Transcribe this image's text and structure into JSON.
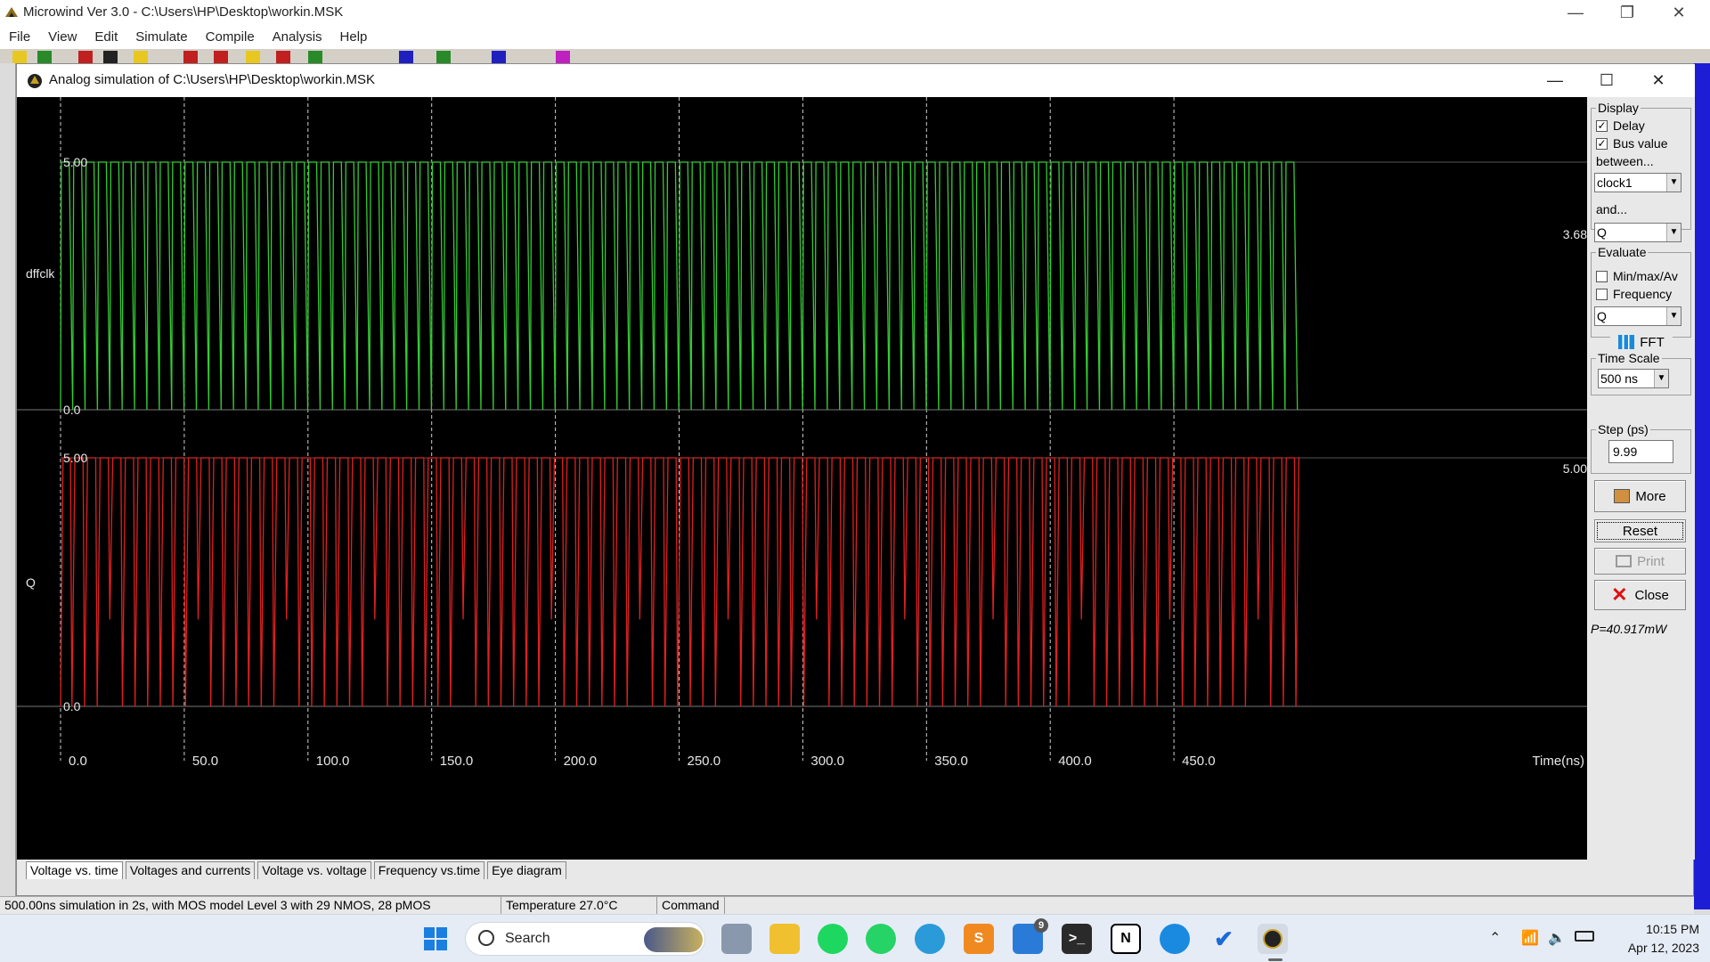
{
  "window": {
    "title": "Microwind Ver 3.0 - C:\\Users\\HP\\Desktop\\workin.MSK",
    "minimize": "—",
    "maximize": "❐",
    "close": "✕"
  },
  "menu": [
    "File",
    "View",
    "Edit",
    "Simulate",
    "Compile",
    "Analysis",
    "Help"
  ],
  "sim": {
    "title": "Analog simulation of C:\\Users\\HP\\Desktop\\workin.MSK",
    "minimize": "—",
    "maximize": "☐",
    "close": "✕"
  },
  "plot": {
    "signals": [
      {
        "name": "dffclk",
        "color": "#33cc33",
        "vmax": "5.00",
        "vmin": "0.0",
        "right_value": "3.68"
      },
      {
        "name": "Q",
        "color": "#e02020",
        "vmax": "5.00",
        "vmin": "0.0",
        "right_value": "5.00"
      }
    ],
    "x_ticks": [
      "0.0",
      "50.0",
      "100.0",
      "150.0",
      "200.0",
      "250.0",
      "300.0",
      "350.0",
      "400.0",
      "450.0"
    ],
    "x_label": "Time(ns)",
    "x_range": [
      0,
      500
    ]
  },
  "panel": {
    "display_label": "Display",
    "delay_label": "Delay",
    "delay_checked": true,
    "busvalue_label": "Bus value",
    "busvalue_checked": true,
    "between_label": "between...",
    "between_value": "clock1",
    "and_label": "and...",
    "and_value": "Q",
    "evaluate_label": "Evaluate",
    "minmax_label": "Min/max/Av",
    "minmax_checked": false,
    "frequency_label": "Frequency",
    "frequency_checked": false,
    "eval_signal": "Q",
    "fft_label": "FFT",
    "timescale_label": "Time Scale",
    "timescale_value": "500 ns",
    "step_label": "Step (ps)",
    "step_value": "9.99",
    "more_label": "More",
    "reset_label": "Reset",
    "print_label": "Print",
    "close_label": "Close",
    "power": "P=40.917mW"
  },
  "tabs": [
    "Voltage vs. time",
    "Voltages and currents",
    "Voltage vs. voltage",
    "Frequency vs.time",
    "Eye diagram"
  ],
  "status": {
    "info": "500.00ns simulation in 2s, with MOS model Level 3 with 29 NMOS, 28 pMOS",
    "temperature": "Temperature 27.0°C",
    "command": "Command"
  },
  "taskbar": {
    "search_placeholder": "Search",
    "mail_badge": "9",
    "time": "10:15 PM",
    "date": "Apr 12, 2023"
  }
}
